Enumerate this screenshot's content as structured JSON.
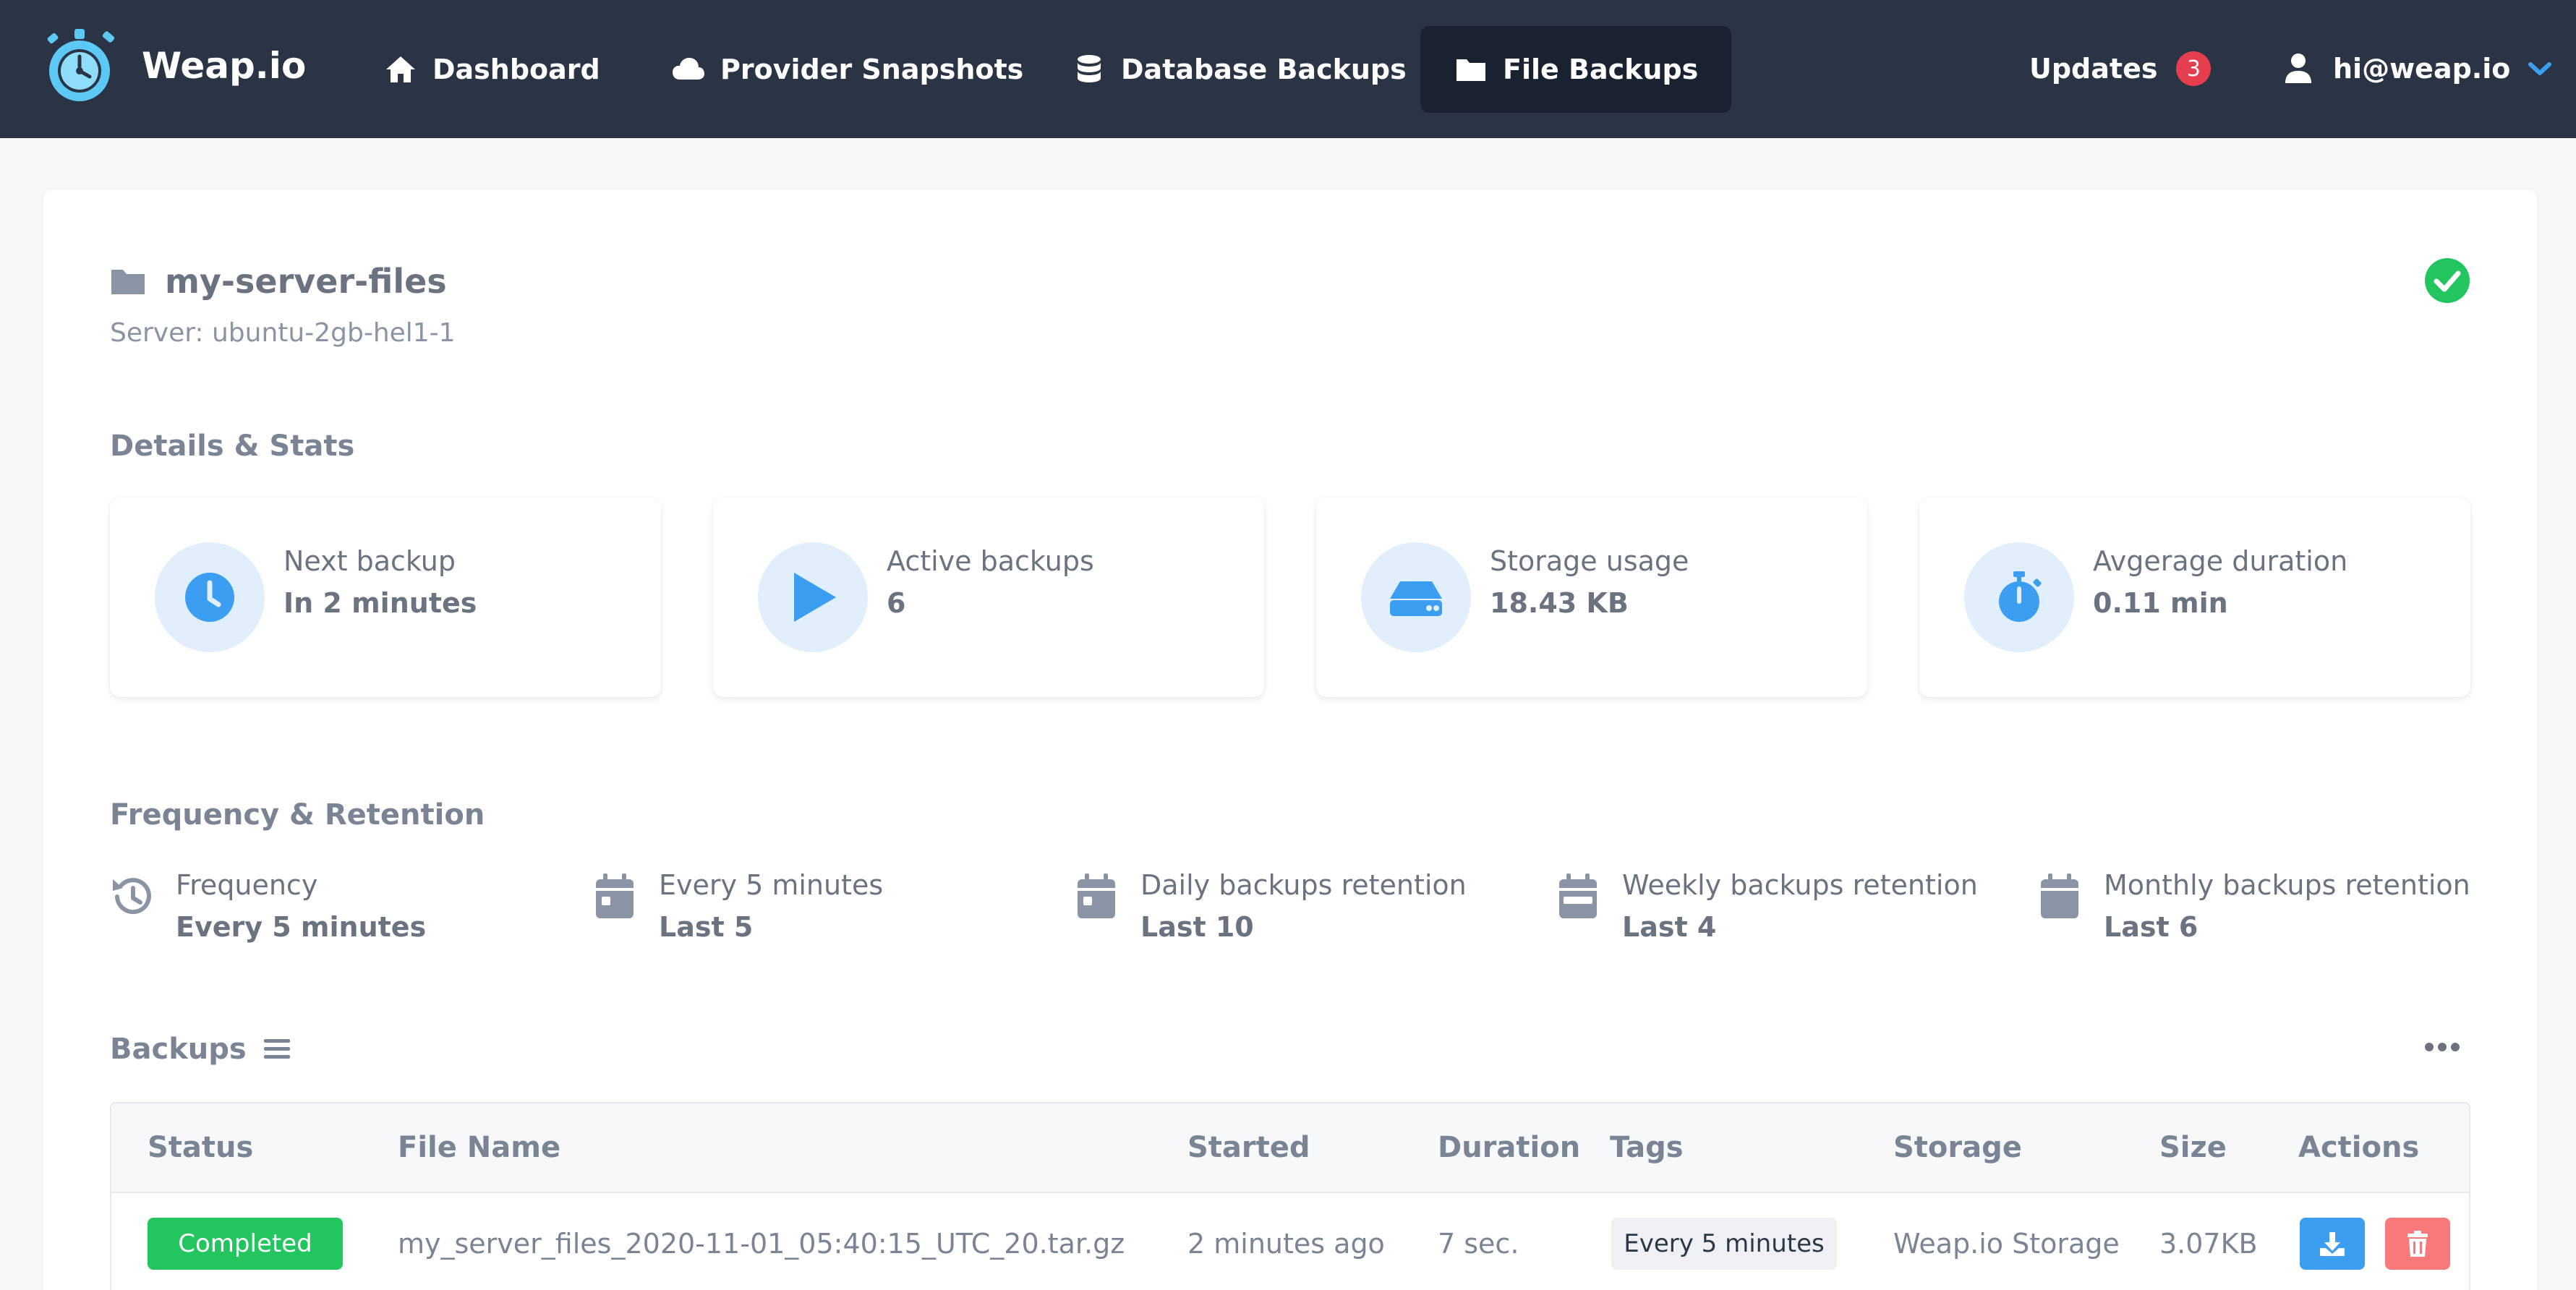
{
  "brand": {
    "name": "Weap.io"
  },
  "nav": {
    "items": [
      {
        "label": "Dashboard",
        "icon": "home-icon"
      },
      {
        "label": "Provider Snapshots",
        "icon": "cloud-icon"
      },
      {
        "label": "Database Backups",
        "icon": "database-icon"
      },
      {
        "label": "File Backups",
        "icon": "folder-icon",
        "active": true
      }
    ],
    "updates_label": "Updates",
    "updates_count": "3",
    "user_email": "hi@weap.io"
  },
  "backup": {
    "title": "my-server-files",
    "server": "Server: ubuntu-2gb-hel1-1",
    "status_icon": "check-circle-icon"
  },
  "details": {
    "heading": "Details & Stats",
    "stats": [
      {
        "label": "Next backup",
        "value": "In 2 minutes",
        "icon": "clock-icon"
      },
      {
        "label": "Active backups",
        "value": "6",
        "icon": "play-icon"
      },
      {
        "label": "Storage usage",
        "value": "18.43 KB",
        "icon": "hard-drive-icon"
      },
      {
        "label": "Avgerage duration",
        "value": "0.11 min",
        "icon": "stopwatch-icon"
      }
    ]
  },
  "frequency": {
    "heading": "Frequency & Retention",
    "items": [
      {
        "label": "Frequency",
        "value": "Every 5 minutes",
        "icon": "history-icon"
      },
      {
        "label": "Every 5 minutes",
        "value": "Last 5",
        "icon": "calendar-icon"
      },
      {
        "label": "Daily backups retention",
        "value": "Last 10",
        "icon": "calendar-icon"
      },
      {
        "label": "Weekly backups retention",
        "value": "Last 4",
        "icon": "calendar-week-icon"
      },
      {
        "label": "Monthly backups retention",
        "value": "Last 6",
        "icon": "calendar-icon"
      }
    ]
  },
  "backups": {
    "heading": "Backups",
    "columns": [
      "Status",
      "File Name",
      "Started",
      "Duration",
      "Tags",
      "Storage",
      "Size",
      "Actions"
    ],
    "rows": [
      {
        "status": "Completed",
        "file_name": "my_server_files_2020-11-01_05:40:15_UTC_20.tar.gz",
        "started": "2 minutes ago",
        "duration": "7 sec.",
        "tag": "Every 5 minutes",
        "storage": "Weap.io Storage",
        "size": "3.07KB"
      }
    ]
  },
  "colors": {
    "topbar": "#2a3445",
    "accent": "#3b9ef0",
    "success": "#22c55e",
    "danger": "#f87979",
    "badge": "#e53e4f"
  }
}
